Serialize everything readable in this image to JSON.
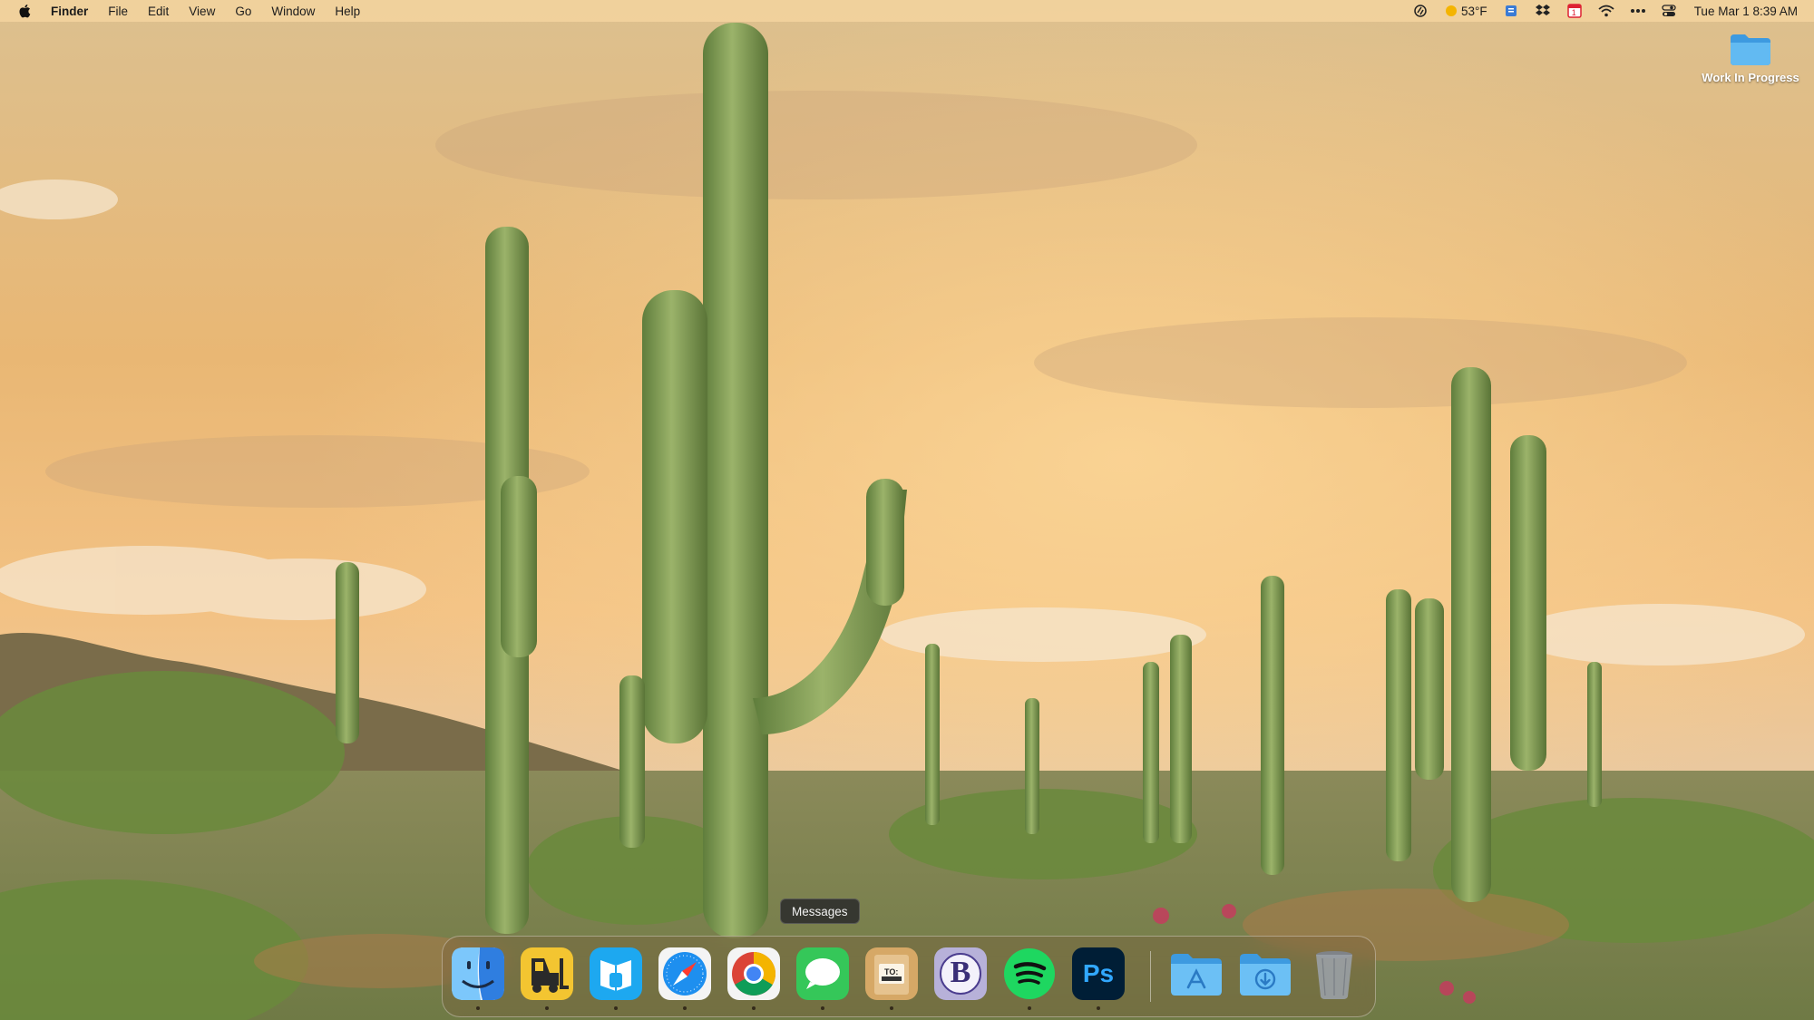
{
  "menubar": {
    "app_name": "Finder",
    "menus": [
      "File",
      "Edit",
      "View",
      "Go",
      "Window",
      "Help"
    ],
    "weather": "53°F",
    "calendar_day": "1",
    "clock": "Tue Mar 1  8:39 AM"
  },
  "desktop": {
    "folder_label": "Work In Progress"
  },
  "dock": {
    "tooltip": "Messages",
    "apps": [
      {
        "name": "Finder",
        "icon": "finder-icon",
        "running": true
      },
      {
        "name": "Forklift",
        "icon": "forklift-icon",
        "running": true
      },
      {
        "name": "Mimestream",
        "icon": "mail-icon",
        "running": true
      },
      {
        "name": "Safari",
        "icon": "safari-icon",
        "running": true
      },
      {
        "name": "Google Chrome",
        "icon": "chrome-icon",
        "running": true
      },
      {
        "name": "Messages",
        "icon": "messages-icon",
        "running": true
      },
      {
        "name": "Deliveries",
        "icon": "deliveries-icon",
        "running": true
      },
      {
        "name": "BBEdit",
        "icon": "bbedit-icon",
        "running": false
      },
      {
        "name": "Spotify",
        "icon": "spotify-icon",
        "running": true
      },
      {
        "name": "Photoshop",
        "icon": "photoshop-icon",
        "running": true
      }
    ],
    "folders": [
      {
        "name": "Applications",
        "icon": "applications-folder-icon"
      },
      {
        "name": "Downloads",
        "icon": "downloads-folder-icon"
      }
    ],
    "trash": {
      "name": "Trash",
      "icon": "trash-icon"
    },
    "photoshop_label": "Ps",
    "bbedit_label": "B",
    "deliveries_label": "TO:"
  },
  "colors": {
    "sky_top": "#e9c48c",
    "sky_glow": "#f5b964",
    "cactus": "#7c9a52",
    "folder_blue": "#5eb5ee"
  }
}
